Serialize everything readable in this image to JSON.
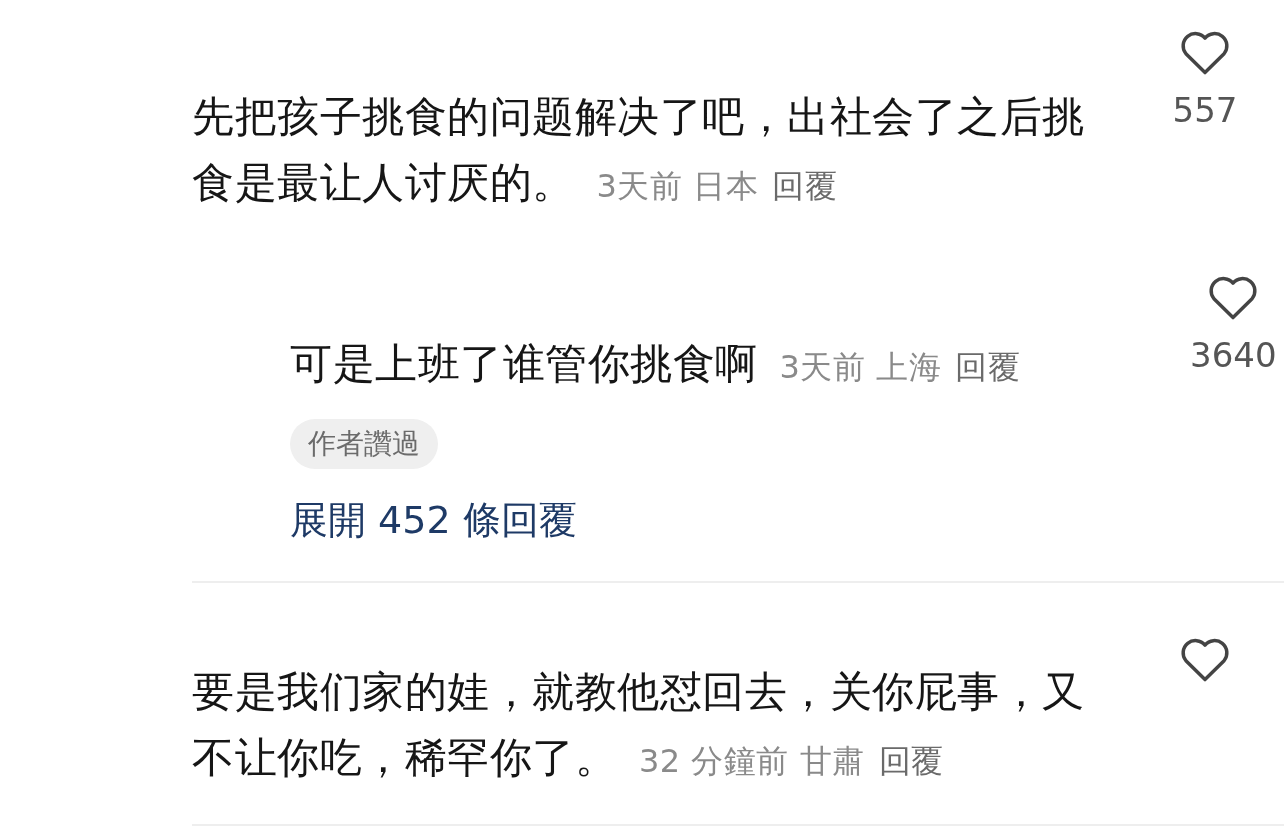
{
  "comments": [
    {
      "text": "先把孩子挑食的问题解决了吧，出社会了之后挑食是最让人讨厌的。",
      "time": "3天前",
      "location": "日本",
      "reply_label": "回覆",
      "likes": "557",
      "replies": [
        {
          "text": "可是上班了谁管你挑食啊",
          "time": "3天前",
          "location": "上海",
          "reply_label": "回覆",
          "likes": "3640",
          "badge": "作者讚過"
        }
      ],
      "expand_label": "展開 452 條回覆"
    },
    {
      "text": "要是我们家的娃，就教他怼回去，关你屁事，又不让你吃，稀罕你了。",
      "time": "32 分鐘前",
      "location": "甘肅",
      "reply_label": "回覆"
    }
  ]
}
